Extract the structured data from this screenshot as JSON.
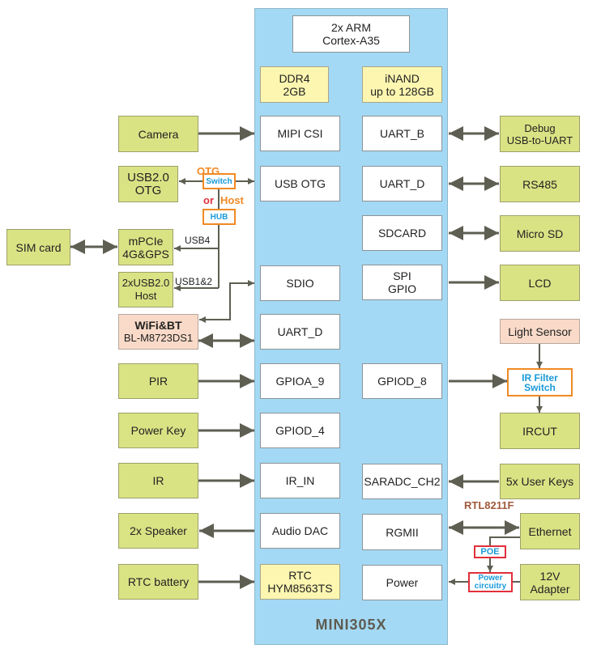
{
  "soc": {
    "title": "MINI305X",
    "cpu": "2x ARM\nCortex-A35",
    "ddr": "DDR4\n2GB",
    "inand": "iNAND\nup to 128GB",
    "left_ports": {
      "mipi": "MIPI CSI",
      "usb_otg": "USB OTG",
      "sdio": "SDIO",
      "uart_d": "UART_D",
      "gpioa9": "GPIOA_9",
      "gpiod4": "GPIOD_4",
      "ir_in": "IR_IN",
      "audio_dac": "Audio DAC",
      "rtc": "RTC\nHYM8563TS"
    },
    "right_ports": {
      "uart_b": "UART_B",
      "uart_d": "UART_D",
      "sdcard": "SDCARD",
      "spi_gpio": "SPI\nGPIO",
      "gpiod8": "GPIOD_8",
      "saradc": "SARADC_CH2",
      "rgmii": "RGMII",
      "power": "Power"
    }
  },
  "left_peripherals": {
    "camera": "Camera",
    "usb_otg": "USB2.0\nOTG",
    "sim": "SIM card",
    "mpcie": "mPCIe\n4G&GPS",
    "usb_host": "2xUSB2.0\nHost",
    "wifi_title": "WiFi&BT",
    "wifi_model": "BL-M8723DS1",
    "pir": "PIR",
    "power_key": "Power Key",
    "ir": "IR",
    "speaker": "2x Speaker",
    "rtc_battery": "RTC battery"
  },
  "right_peripherals": {
    "debug": "Debug\nUSB-to-UART",
    "rs485": "RS485",
    "micro_sd": "Micro SD",
    "lcd": "LCD",
    "light_sensor": "Light Sensor",
    "ir_filter": "IR Filter\nSwitch",
    "ircut": "IRCUT",
    "user_keys": "5x User Keys",
    "ethernet": "Ethernet",
    "adapter": "12V\nAdapter"
  },
  "usb_routing": {
    "switch": "Switch",
    "hub": "HUB",
    "otg_label": "OTG",
    "or_label": "or",
    "host_label": "Host",
    "usb4_label": "USB4",
    "usb12_label": "USB1&2"
  },
  "power_routing": {
    "phy_label": "RTL8211F",
    "poe": "POE",
    "power_circuitry": "Power\ncircuitry"
  },
  "colors": {
    "soc_bg": "#a3d9f4",
    "peripheral_green": "#dae384",
    "memory_yellow": "#fdf6b0",
    "wireless_peach": "#f9dac8",
    "arrow": "#5e5e52",
    "accent_orange": "#f08a24",
    "accent_blue": "#1a9ad8",
    "accent_red": "#e0303a",
    "phy_brown": "#a0583a"
  }
}
